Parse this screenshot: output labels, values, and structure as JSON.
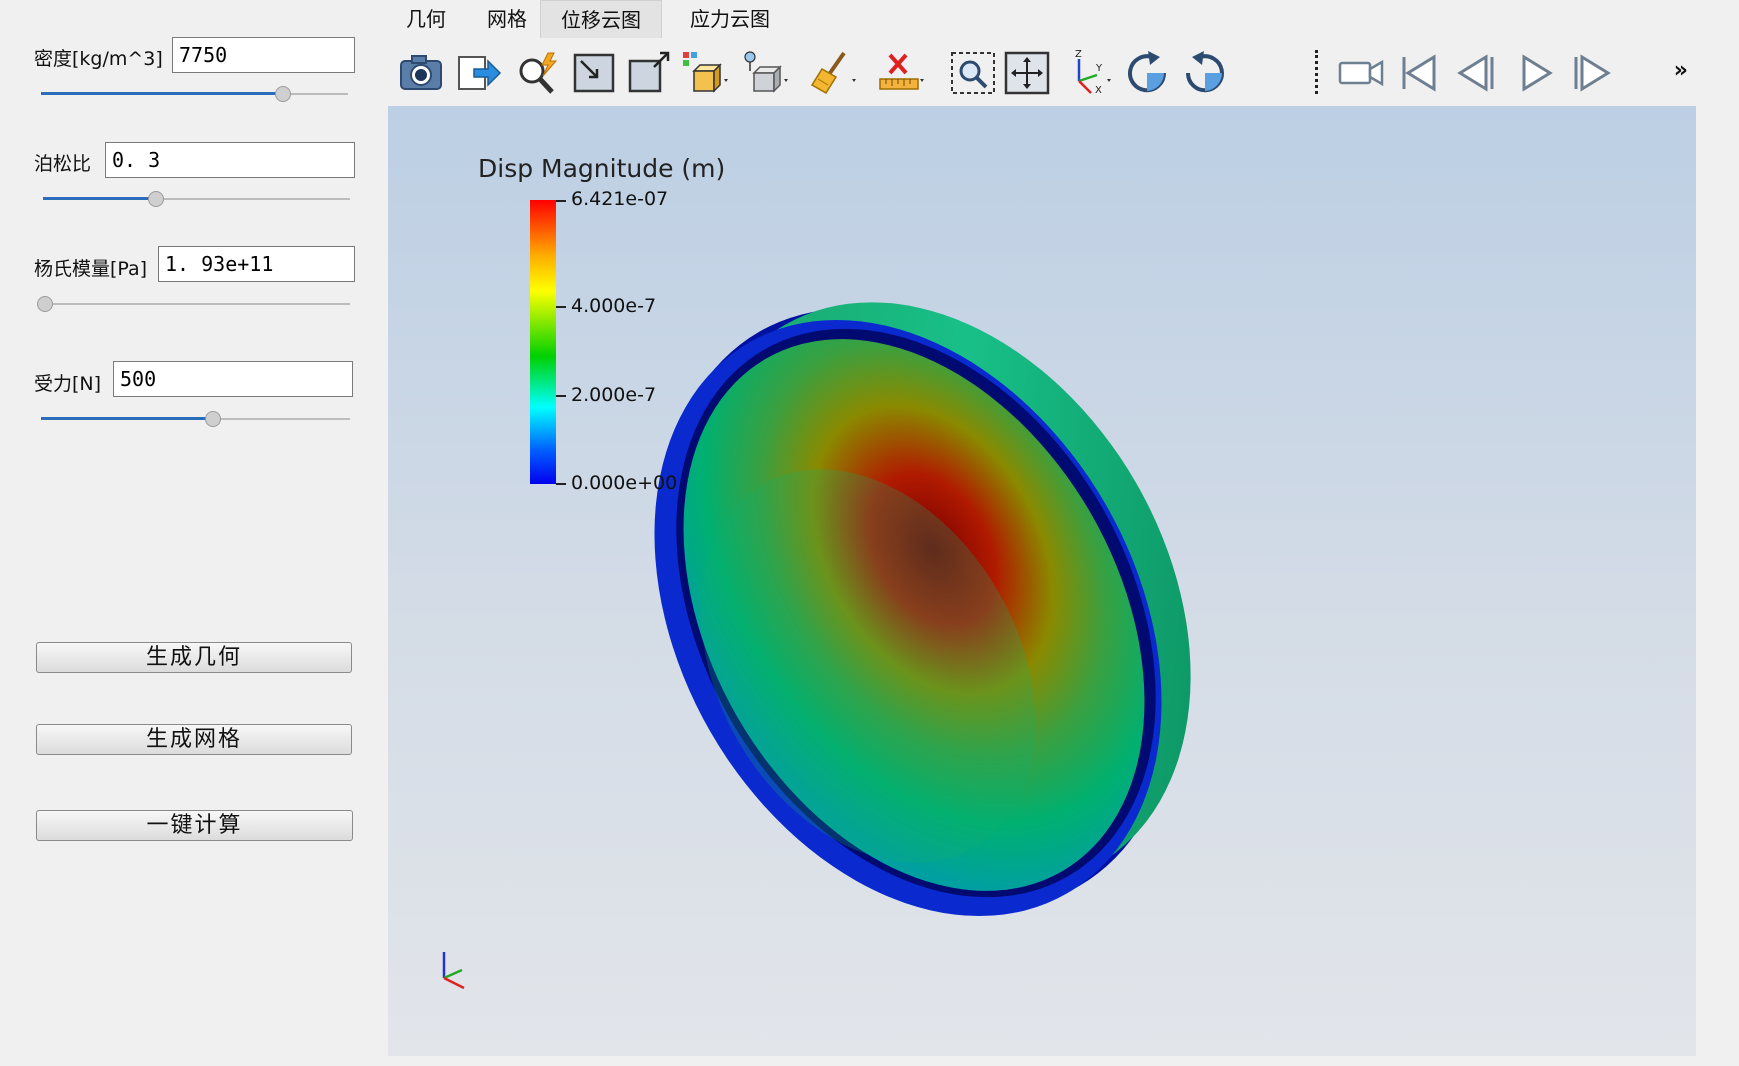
{
  "params": {
    "density": {
      "label": "密度[kg/m^3]",
      "value": "7750",
      "slider_fraction": 0.8
    },
    "poisson": {
      "label": "泊松比",
      "value": "0. 3",
      "slider_fraction": 0.37
    },
    "youngs": {
      "label": "杨氏模量[Pa]",
      "value": "1. 93e+11",
      "slider_fraction": 0.0
    },
    "force": {
      "label": "受力[N]",
      "value": "500",
      "slider_fraction": 0.55
    }
  },
  "buttons": {
    "gen_geometry": "生成几何",
    "gen_mesh": "生成网格",
    "compute": "一键计算"
  },
  "tabs": [
    {
      "label": "几何"
    },
    {
      "label": "网格"
    },
    {
      "label": "位移云图",
      "active": true
    },
    {
      "label": "应力云图"
    }
  ],
  "toolbar": {
    "icons": [
      "camera-icon",
      "export-icon",
      "probe-icon",
      "reset-camera-icon",
      "view-box-icon",
      "select-cells-icon",
      "select-points-icon",
      "clear-broom-icon",
      "ruler-delete-icon",
      "zoom-box-icon",
      "center-view-icon",
      "axes-orient-icon",
      "rotate-cw-icon",
      "rotate-ccw-icon",
      "record-icon",
      "first-frame-icon",
      "prev-frame-icon",
      "play-icon",
      "next-frame-icon"
    ],
    "overflow": "»"
  },
  "legend": {
    "title": "Disp Magnitude (m)",
    "labels": [
      "6.421e-07",
      "4.000e-7",
      "2.000e-7",
      "0.000e+00"
    ],
    "colors": {
      "max": "#ff0000",
      "mid": "#00d000",
      "min": "#0000ee"
    }
  }
}
